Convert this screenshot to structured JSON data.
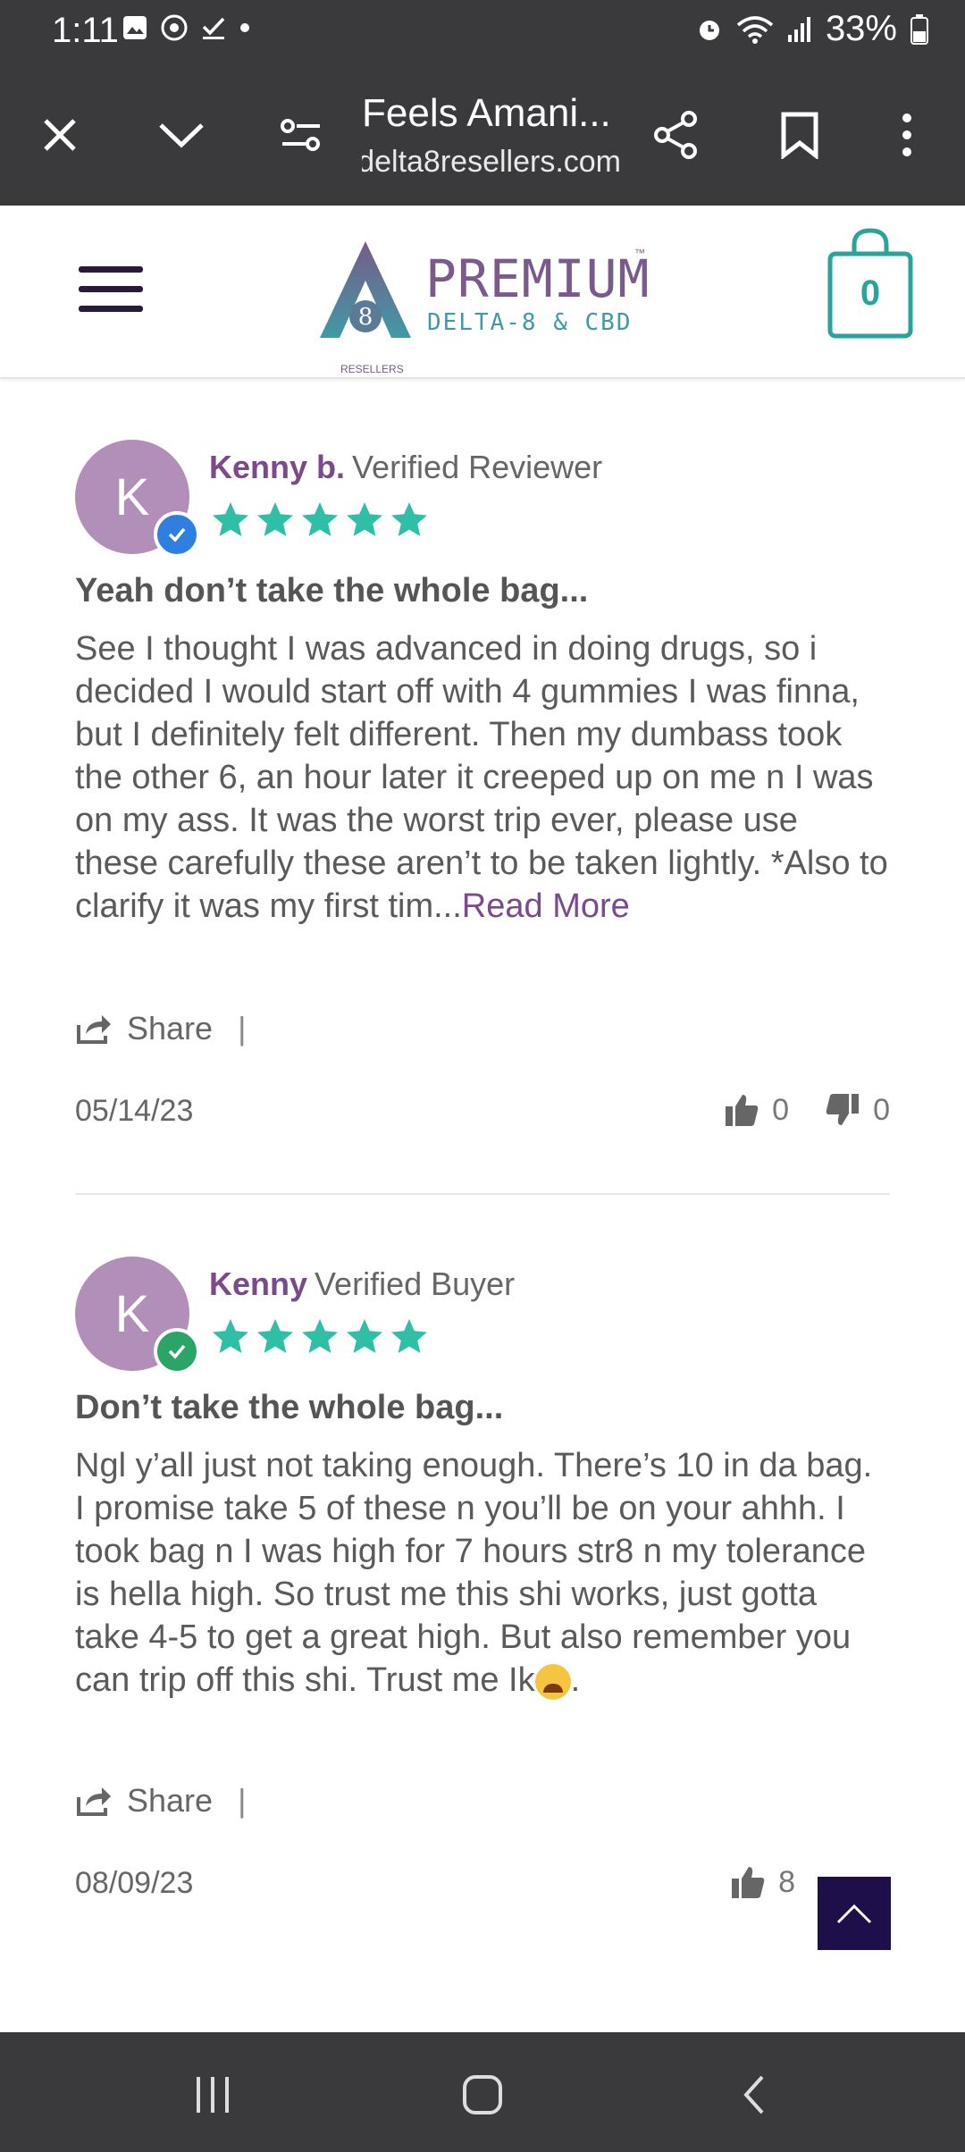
{
  "status": {
    "time": "1:11",
    "battery": "33%"
  },
  "browser": {
    "title": "Feels Amani...",
    "url": "delta8resellers.com"
  },
  "site": {
    "logo_main": "PREMIUM",
    "logo_tm": "™",
    "logo_sub": "DELTA-8 & CBD",
    "logo_resellers": "RESELLERS",
    "cart_count": "0"
  },
  "reviews": [
    {
      "initial": "K",
      "name": "Kenny b.",
      "verified": "Verified Reviewer",
      "badge_color": "#2f7fe0",
      "rating": 5,
      "title": "Yeah don’t take the whole bag...",
      "body": "See I thought I was advanced in doing drugs, so i decided I would start off with 4 gummies I was finna, but I definitely felt different. Then my dumbass took the other 6, an hour later it creeped up on me n I was on my ass. It was the worst trip ever, please use these carefully these aren’t to be taken lightly. *Also to clarify it was my first tim...",
      "read_more": "Read More",
      "share": "Share",
      "date": "05/14/23",
      "up": "0",
      "down": "0"
    },
    {
      "initial": "K",
      "name": "Kenny",
      "verified": "Verified Buyer",
      "badge_color": "#2aa566",
      "rating": 5,
      "title": "Don’t take the whole bag...",
      "body": "Ngl y’all just not taking enough. There’s 10 in da bag. I promise take 5 of these n you’ll be on your ahhh. I took bag n I was high for 7 hours str8 n my tolerance is hella high. So trust me this shi works, just gotta take 4-5 to get a great high. But also remember you can trip off this shi. Trust me Ik",
      "body_end": ".",
      "share": "Share",
      "date": "08/09/23",
      "up": "8"
    }
  ],
  "colors": {
    "star": "#2fbfa6",
    "accent": "#7a4a8a",
    "teal": "#2aa39a",
    "dark": "#3a3a3c"
  }
}
